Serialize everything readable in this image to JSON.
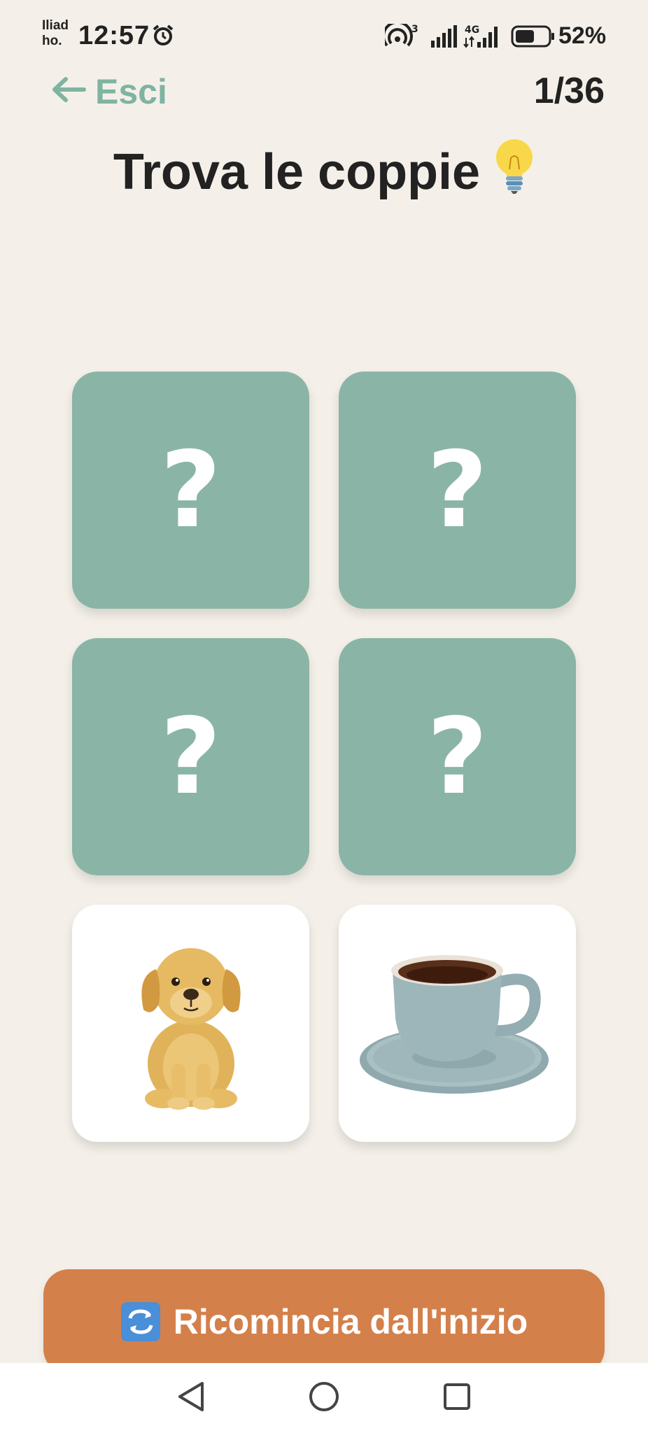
{
  "status_bar": {
    "carrier": "Iliad ho.",
    "time": "12:57",
    "battery": "52%",
    "icons": [
      "alarm-icon",
      "hotspot-icon",
      "signal-icon",
      "4g-icon",
      "battery-icon"
    ]
  },
  "header": {
    "back_label": "Esci",
    "progress": "1/36",
    "title": "Trova le coppie"
  },
  "cards": [
    {
      "state": "hidden",
      "symbol": "?"
    },
    {
      "state": "hidden",
      "symbol": "?"
    },
    {
      "state": "hidden",
      "symbol": "?"
    },
    {
      "state": "hidden",
      "symbol": "?"
    },
    {
      "state": "revealed",
      "content": "puppy"
    },
    {
      "state": "revealed",
      "content": "coffee-cup"
    }
  ],
  "restart_button": {
    "label": "Ricomincia dall'inizio"
  },
  "colors": {
    "background": "#f4f0e9",
    "card_hidden": "#8ab5a6",
    "accent_green": "#7fb3a2",
    "restart_orange": "#d4804b"
  }
}
